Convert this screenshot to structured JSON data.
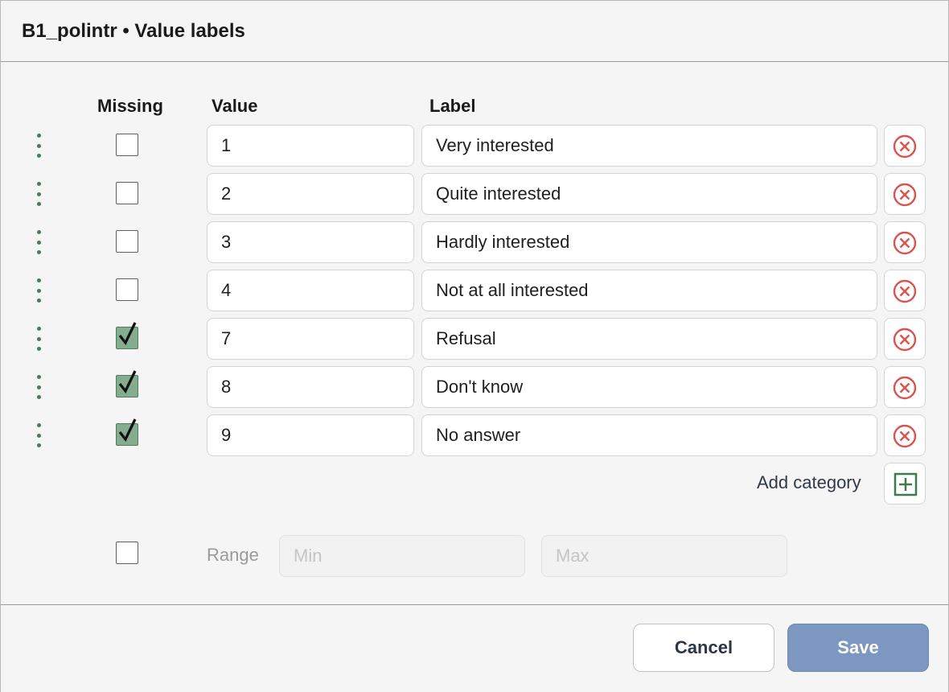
{
  "dialog": {
    "title": "B1_polintr • Value labels"
  },
  "columns": {
    "missing": "Missing",
    "value": "Value",
    "label": "Label"
  },
  "rows": [
    {
      "value": "1",
      "label": "Very interested",
      "missing": false
    },
    {
      "value": "2",
      "label": "Quite interested",
      "missing": false
    },
    {
      "value": "3",
      "label": "Hardly interested",
      "missing": false
    },
    {
      "value": "4",
      "label": "Not at all interested",
      "missing": false
    },
    {
      "value": "7",
      "label": "Refusal",
      "missing": true
    },
    {
      "value": "8",
      "label": "Don't know",
      "missing": true
    },
    {
      "value": "9",
      "label": "No answer",
      "missing": true
    }
  ],
  "add_category": {
    "label": "Add category"
  },
  "range": {
    "label": "Range",
    "enabled": false,
    "min_placeholder": "Min",
    "max_placeholder": "Max",
    "min_value": "",
    "max_value": ""
  },
  "footer": {
    "cancel_label": "Cancel",
    "save_label": "Save"
  },
  "icons": {
    "drag": "drag-handle-icon",
    "check": "checkmark-icon",
    "delete": "circle-x-icon",
    "add": "square-plus-icon"
  },
  "colors": {
    "delete_icon": "#d9534f",
    "add_icon": "#3f7a4e",
    "checked_fill": "#83ad8e",
    "drag_dots": "#4b7a58",
    "save_button": "#7d98c0"
  }
}
